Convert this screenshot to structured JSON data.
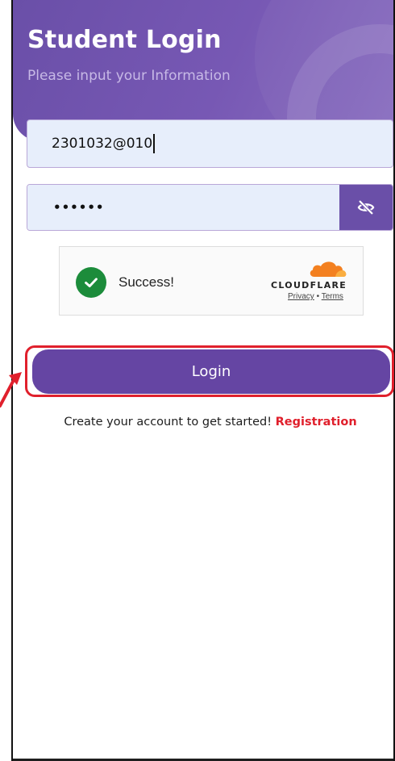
{
  "header": {
    "title": "Student Login",
    "subtitle": "Please input your Information"
  },
  "form": {
    "student_id_value": "2301032@010",
    "password_value": "••••••"
  },
  "captcha": {
    "status_text": "Success!",
    "provider": "CLOUDFLARE",
    "privacy_label": "Privacy",
    "separator": "•",
    "terms_label": "Terms"
  },
  "login_button": {
    "label": "Login"
  },
  "registration": {
    "prompt": "Create your account to get started!",
    "link_label": "Registration"
  },
  "colors": {
    "brand_purple": "#6a4fa8",
    "accent_red": "#e0202c",
    "success_green": "#1c8c3b",
    "cloudflare_orange": "#f38020"
  },
  "icons": {
    "password_toggle": "eye-slash-icon",
    "captcha_status": "checkmark-circle-icon",
    "captcha_provider": "cloudflare-logo-icon",
    "annotation": "red-arrow-icon"
  }
}
